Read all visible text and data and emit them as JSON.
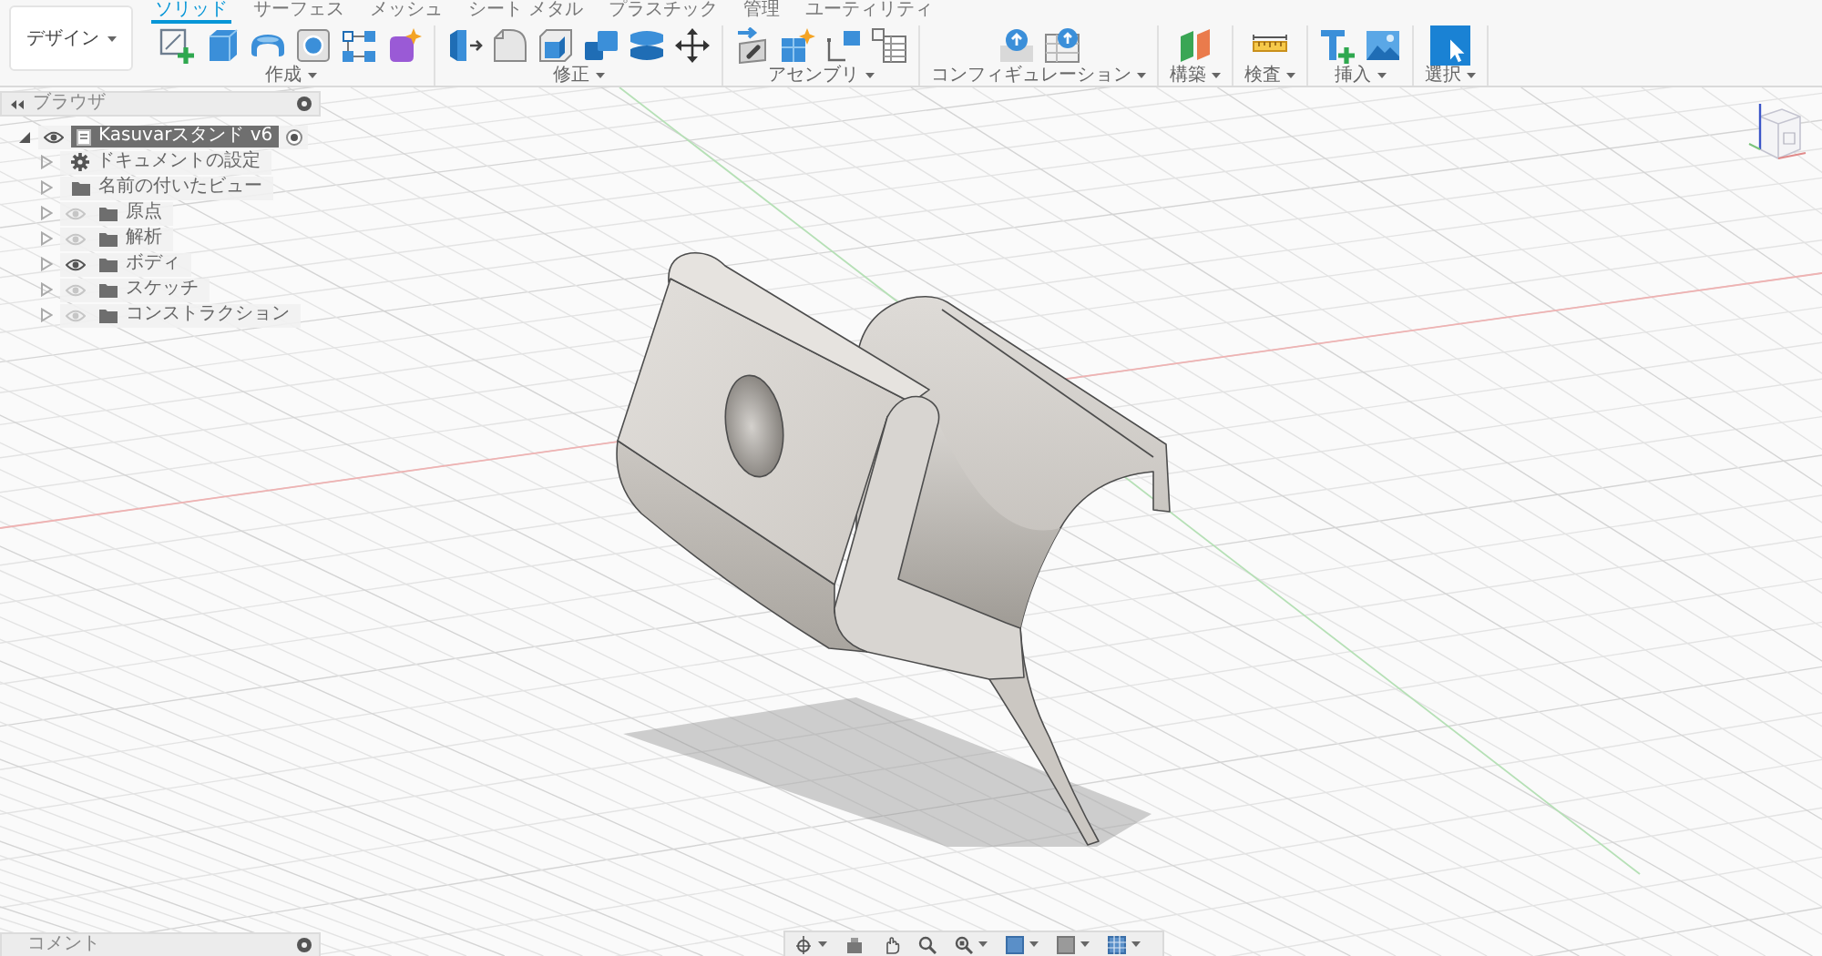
{
  "workspace": {
    "label": "デザイン"
  },
  "tabs": [
    {
      "label": "ソリッド",
      "selected": true
    },
    {
      "label": "サーフェス",
      "selected": false
    },
    {
      "label": "メッシュ",
      "selected": false
    },
    {
      "label": "シート メタル",
      "selected": false
    },
    {
      "label": "プラスチック",
      "selected": false
    },
    {
      "label": "管理",
      "selected": false
    },
    {
      "label": "ユーティリティ",
      "selected": false
    }
  ],
  "groups": [
    {
      "label": "作成",
      "tools": [
        {
          "kind": "sketch"
        },
        {
          "kind": "extrude"
        },
        {
          "kind": "revolve"
        },
        {
          "kind": "hole"
        },
        {
          "kind": "pattern"
        },
        {
          "kind": "form"
        }
      ]
    },
    {
      "label": "修正",
      "tools": [
        {
          "kind": "presspull"
        },
        {
          "kind": "fillet"
        },
        {
          "kind": "shell"
        },
        {
          "kind": "combine"
        },
        {
          "kind": "split"
        },
        {
          "kind": "move"
        }
      ]
    },
    {
      "label": "アセンブリ",
      "tools": [
        {
          "kind": "joint"
        },
        {
          "kind": "component"
        },
        {
          "kind": "rigid"
        },
        {
          "kind": "table"
        }
      ]
    },
    {
      "label": "コンフィギュレーション",
      "tools": [
        {
          "kind": "config"
        },
        {
          "kind": "configtable"
        }
      ]
    },
    {
      "label": "構築",
      "tools": [
        {
          "kind": "plane"
        }
      ]
    },
    {
      "label": "検査",
      "tools": [
        {
          "kind": "measure"
        }
      ]
    },
    {
      "label": "挿入",
      "tools": [
        {
          "kind": "insert"
        },
        {
          "kind": "image"
        }
      ]
    },
    {
      "label": "選択",
      "tools": [
        {
          "kind": "select"
        }
      ]
    }
  ],
  "browser": {
    "title": "ブラウザ",
    "tree": [
      {
        "label": "Kasuvarスタンド v6",
        "kind": "component",
        "expanded": true,
        "visible": true,
        "selected": true,
        "active": true,
        "children": [
          {
            "label": "ドキュメントの設定",
            "kind": "settings",
            "expanded": false,
            "selected": false
          },
          {
            "label": "名前の付いたビュー",
            "kind": "folder",
            "expanded": false,
            "selected": false
          },
          {
            "label": "原点",
            "kind": "folder",
            "expanded": false,
            "visible": false,
            "selected": false
          },
          {
            "label": "解析",
            "kind": "folder",
            "expanded": false,
            "visible": false,
            "selected": false
          },
          {
            "label": "ボディ",
            "kind": "folder",
            "expanded": false,
            "visible": true,
            "selected": false
          },
          {
            "label": "スケッチ",
            "kind": "folder",
            "expanded": false,
            "visible": false,
            "selected": false
          },
          {
            "label": "コンストラクション",
            "kind": "folder",
            "expanded": false,
            "visible": false,
            "selected": false
          }
        ]
      }
    ]
  },
  "comments": {
    "title": "コメント"
  },
  "nav_bar": {
    "tools": [
      {
        "kind": "orbit",
        "dropdown": true
      },
      {
        "kind": "look",
        "dropdown": false
      },
      {
        "kind": "pan",
        "dropdown": false
      },
      {
        "kind": "zoom",
        "dropdown": false
      },
      {
        "kind": "fit",
        "dropdown": true
      },
      {
        "kind": "display",
        "dropdown": true
      },
      {
        "kind": "visual",
        "dropdown": true
      },
      {
        "kind": "grid",
        "dropdown": true
      }
    ]
  }
}
